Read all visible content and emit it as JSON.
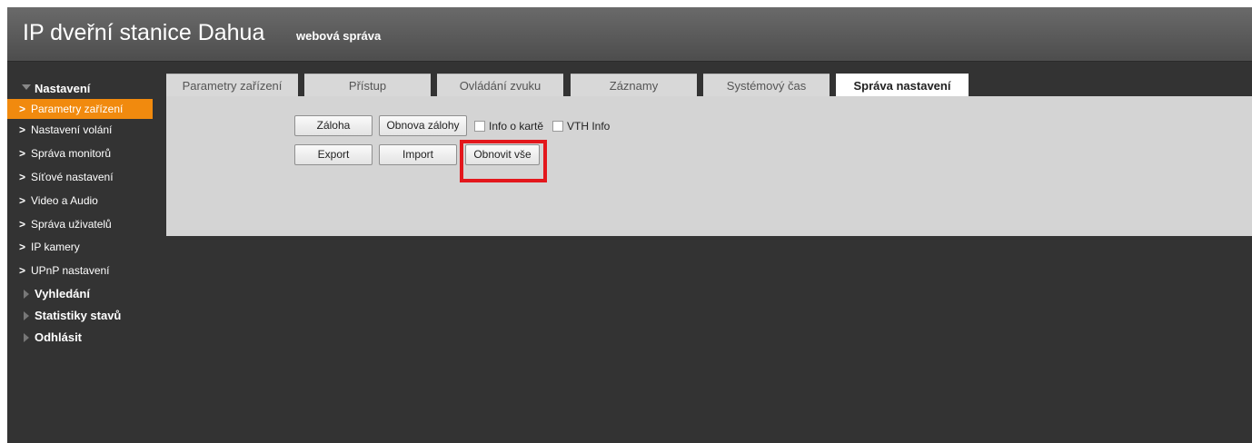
{
  "header": {
    "title": "IP dveřní stanice Dahua",
    "subtitle": "webová správa"
  },
  "sidebar": {
    "groups": [
      {
        "label": "Nastavení",
        "expanded": true,
        "items": [
          {
            "label": "Parametry zařízení",
            "active": true
          },
          {
            "label": "Nastavení volání"
          },
          {
            "label": "Správa monitorů"
          },
          {
            "label": "Síťové nastavení"
          },
          {
            "label": "Video a Audio"
          },
          {
            "label": "Správa uživatelů"
          },
          {
            "label": "IP kamery"
          },
          {
            "label": "UPnP nastavení"
          }
        ]
      },
      {
        "label": "Vyhledání",
        "expanded": false
      },
      {
        "label": "Statistiky stavů",
        "expanded": false
      },
      {
        "label": "Odhlásit",
        "expanded": false
      }
    ]
  },
  "tabs": [
    {
      "label": "Parametry zařízení"
    },
    {
      "label": "Přístup"
    },
    {
      "label": "Ovládání zvuku"
    },
    {
      "label": "Záznamy"
    },
    {
      "label": "Systémový čas"
    },
    {
      "label": "Správa nastavení",
      "active": true
    }
  ],
  "panel": {
    "backup_label": "Záloha",
    "restore_backup_label": "Obnova zálohy",
    "card_info_label": "Info o kartě",
    "card_info_checked": false,
    "vth_info_label": "VTH Info",
    "vth_info_checked": false,
    "export_label": "Export",
    "import_label": "Import",
    "restore_all_label": "Obnovit vše"
  },
  "colors": {
    "accent": "#f18a0e",
    "highlight": "#e3171c",
    "background": "#333333",
    "panel": "#d4d4d4"
  }
}
